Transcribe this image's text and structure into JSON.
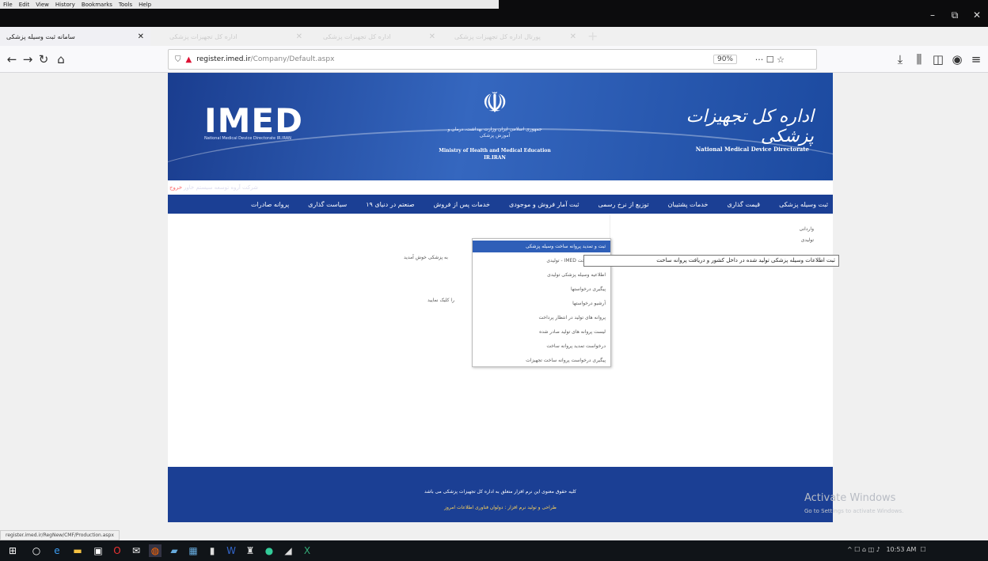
{
  "menu_bar": [
    "File",
    "Edit",
    "View",
    "History",
    "Bookmarks",
    "Tools",
    "Help"
  ],
  "window_controls": [
    "–",
    "⧉",
    "✕"
  ],
  "tabs": [
    {
      "label": "سامانه ثبت وسیله پزشکی",
      "active": true
    },
    {
      "label": "اداره کل تجهیزات پزشکی",
      "active": false
    },
    {
      "label": "اداره کل تجهیزات پزشکی",
      "active": false
    },
    {
      "label": "پورتال اداره کل تجهیزات پزشکی",
      "active": false
    }
  ],
  "new_tab": "+",
  "url": {
    "host": "register.imed.ir",
    "path": "/Company/Default.aspx",
    "zoom": "90%",
    "more": "··· ☐ ☆"
  },
  "banner": {
    "logo": "IMED",
    "logo_sub": "National Medical Device Directorate IR.IRAN",
    "emblem": "☫",
    "ministry_fa": "جمهوری اسلامی ایران وزارت بهداشت، درمان و آموزش پزشکی",
    "ministry_en": "Ministry of Health and Medical Education IR.IRAN",
    "brand_fa": "اداره کل تجهیزات پزشکی",
    "brand_en": "National Medical Device Directorate",
    "stripe_link": "خروج",
    "stripe_text": "شرکت آروه توسعه سیستم خاور"
  },
  "nav": [
    "ثبت وسیله پزشکی",
    "قیمت گذاری",
    "خدمات پشتیبان",
    "توزیع از نرخ رسمی",
    "ثبت آمار فروش و موجودی",
    "خدمات پس از فروش",
    "صنعتم در دنیای ۱۹",
    "سیاست گذاری",
    "پروانه صادرات"
  ],
  "sidebox": [
    "واردانی",
    "تولیدی"
  ],
  "dropdown": [
    "ثبت و تمدید پروانه ساخت وسیله پزشکی",
    "تولیدی - IMED سامانه ساخت",
    "اطلاعیه وسیله پزشکی تولیدی",
    "پیگیری درخواستها",
    "آرشیو درخواستها",
    "پروانه های تولید در انتظار پرداخت",
    "لیست پروانه های تولید صادر شده",
    "درخواست تمدید پروانه ساخت",
    "پیگیری درخواست پروانه ساخت تجهیزات"
  ],
  "tooltip": "ثبت اطلاعات وسیله پزشکی تولید شده در داخل کشور و دریافت پروانه ساخت",
  "welcome": "به پزشکی خوش آمدید",
  "welcome2": "را کلیک نمایید",
  "footer": {
    "line1": "کلیه حقوق معنوی این نرم افزار متعلق به اداره کل تجهیزات پزشکی می باشد",
    "line2": "طراحی و تولید نرم افزار : دولوان فناوری اطلاعات امروز"
  },
  "activate": {
    "title": "Activate Windows",
    "sub": "Go to Settings to activate Windows."
  },
  "status_url": "register.imed.ir/RegNew/CMF/Production.aspx",
  "clock": "10:53 AM",
  "tray": "^ ☐ ⌂ ◫ ♪"
}
